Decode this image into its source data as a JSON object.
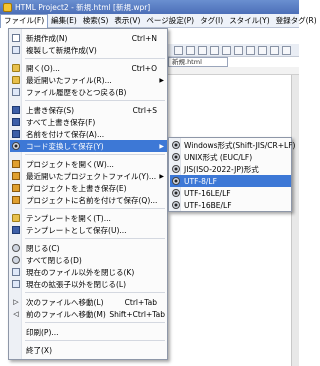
{
  "window": {
    "title": "HTML Project2 - 新規.html [新規.wpr]"
  },
  "menubar": [
    "ファイル(F)",
    "編集(E)",
    "検索(S)",
    "表示(V)",
    "ページ設定(P)",
    "タグ(I)",
    "スタイル(Y)",
    "登録タグ(R)"
  ],
  "background": {
    "tab_label": "新規.html"
  },
  "file_menu": {
    "new": {
      "label": "新規作成(N)",
      "shortcut": "Ctrl+N"
    },
    "copy_new": {
      "label": "複製して新規作成(V)"
    },
    "open": {
      "label": "開く(O)...",
      "shortcut": "Ctrl+O"
    },
    "recent": {
      "label": "最近開いたファイル(R)..."
    },
    "back_history": {
      "label": "ファイル履歴をひとつ戻る(B)"
    },
    "save": {
      "label": "上書き保存(S)",
      "shortcut": "Ctrl+S"
    },
    "save_all": {
      "label": "すべて上書き保存(F)"
    },
    "save_as": {
      "label": "名前を付けて保存(A)..."
    },
    "save_encoding": {
      "label": "コード変換して保存(Y)"
    },
    "open_project": {
      "label": "プロジェクトを開く(W)..."
    },
    "recent_project": {
      "label": "最近開いたプロジェクトファイル(Y)..."
    },
    "save_project": {
      "label": "プロジェクトを上書き保存(E)"
    },
    "save_project_as": {
      "label": "プロジェクトに名前を付けて保存(Q)..."
    },
    "open_template": {
      "label": "テンプレートを開く(T)..."
    },
    "save_template": {
      "label": "テンプレートとして保存(U)..."
    },
    "close": {
      "label": "閉じる(C)"
    },
    "close_all": {
      "label": "すべて閉じる(D)"
    },
    "close_others": {
      "label": "現在のファイル以外を閉じる(K)"
    },
    "close_other_ext": {
      "label": "現在の拡張子以外を閉じる(L)"
    },
    "next_file": {
      "label": "次のファイルへ移動(L)",
      "shortcut": "Ctrl+Tab"
    },
    "prev_file": {
      "label": "前のファイルへ移動(M)",
      "shortcut": "Shift+Ctrl+Tab"
    },
    "print": {
      "label": "印刷(P)..."
    },
    "exit": {
      "label": "終了(X)"
    }
  },
  "encoding_submenu": {
    "shift_jis": "Windows形式(Shift-JIS/CR+LF)",
    "euc": "UNIX形式 (EUC/LF)",
    "jis": "JIS(ISO-2022-JP)形式",
    "utf8": "UTF-8/LF",
    "utf16le": "UTF-16LE/LF",
    "utf16be": "UTF-16BE/LF"
  },
  "colors": {
    "highlight": "#3d78d6",
    "titlebar": "#4c6fb8"
  }
}
